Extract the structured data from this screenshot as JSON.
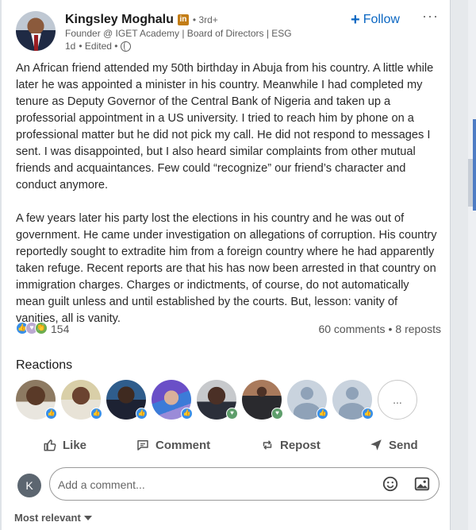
{
  "author": {
    "name": "Kingsley Moghalu",
    "badge": "in",
    "degree": "• 3rd+",
    "headline": "Founder @ IGET Academy | Board of Directors | ESG",
    "time": "1d",
    "edited": "• Edited •"
  },
  "follow_label": "Follow",
  "more_label": "···",
  "post": {
    "paragraphs": [
      "An African friend attended my 50th birthday in Abuja from his country. A little while later he was appointed a minister in his country. Meanwhile I had completed my tenure as Deputy Governor of the Central Bank of Nigeria and taken up a professorial appointment in a US university. I tried to reach him by phone on a professional matter but he did not pick my call. He did not respond to messages I sent. I was disappointed, but I also heard similar complaints from other mutual friends and acquaintances. Few could “recognize” our friend’s character and conduct anymore.",
      "A few years later his party lost the elections in his country and he was out of government. He came under investigation on allegations of corruption. His country reportedly sought to extradite him from a foreign country where he had apparently taken refuge. Recent reports are that his has now been arrested in that country on immigration charges. Charges or indictments, of course, do not automatically mean guilt unless and until established by the courts. But, lesson: vanity of vanities, all is vanity."
    ]
  },
  "social": {
    "reaction_count": "154",
    "comments": "60 comments",
    "separator": "•",
    "reposts": "8 reposts"
  },
  "reactions_title": "Reactions",
  "reactors_more": "...",
  "actions": {
    "like": "Like",
    "comment": "Comment",
    "repost": "Repost",
    "send": "Send"
  },
  "comment_box": {
    "avatar_letter": "K",
    "placeholder": "Add a comment..."
  },
  "sort_label": "Most relevant",
  "colors": {
    "accent": "#0a66c2",
    "like": "#378fe9",
    "celebrate": "#6dae4f",
    "support": "#bba9d1"
  }
}
